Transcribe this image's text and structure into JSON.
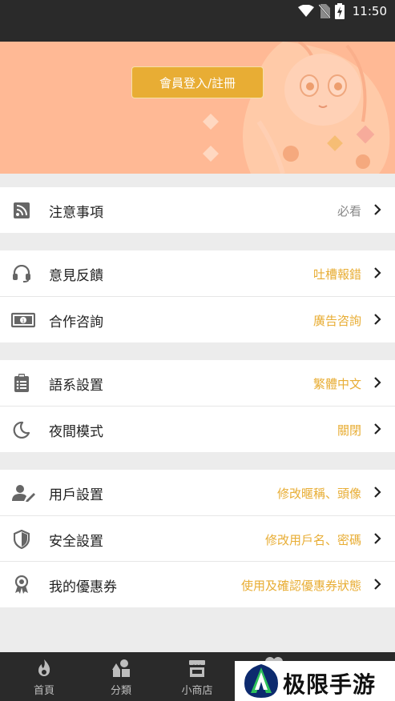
{
  "status_bar": {
    "time": "11:50",
    "icons": [
      "wifi-icon",
      "no-sim-icon",
      "battery-charging-icon"
    ]
  },
  "banner": {
    "login_label": "會員登入/註冊"
  },
  "menu": {
    "notice": {
      "label": "注意事項",
      "value": "必看",
      "icon": "rss-icon"
    },
    "feedback": {
      "label": "意見反饋",
      "value": "吐槽報錯",
      "icon": "headset-icon"
    },
    "cooperation": {
      "label": "合作咨詢",
      "value": "廣告咨詢",
      "icon": "money-icon"
    },
    "language": {
      "label": "語系設置",
      "value": "繁體中文",
      "icon": "clipboard-icon"
    },
    "night_mode": {
      "label": "夜間模式",
      "value": "關閉",
      "icon": "moon-icon"
    },
    "user_settings": {
      "label": "用戶設置",
      "value": "修改暱稱、頭像",
      "icon": "user-edit-icon"
    },
    "security": {
      "label": "安全設置",
      "value": "修改用戶名、密碼",
      "icon": "shield-icon"
    },
    "coupons": {
      "label": "我的優惠券",
      "value": "使用及確認優惠券狀態",
      "icon": "award-icon"
    }
  },
  "tab_bar": {
    "tabs": [
      {
        "label": "首頁",
        "icon": "flame-icon"
      },
      {
        "label": "分類",
        "icon": "shapes-icon"
      },
      {
        "label": "小商店",
        "icon": "store-icon"
      }
    ]
  },
  "watermark": {
    "text": "极限手游网"
  },
  "colors": {
    "accent": "#e8ad34",
    "banner": "#ffb995",
    "dark": "#2a2a2a",
    "page_bg": "#ececec"
  }
}
